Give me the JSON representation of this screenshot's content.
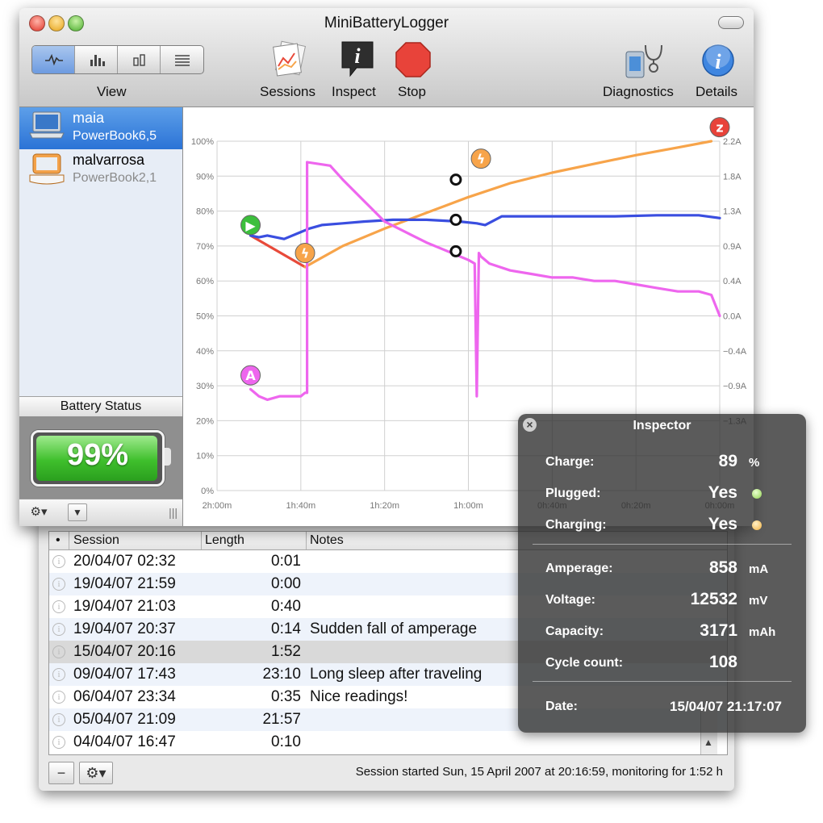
{
  "sessions_window": {
    "columns": [
      "•",
      "Session",
      "Length",
      "Notes"
    ],
    "rows": [
      {
        "date": "20/04/07 02:32",
        "length": "0:01",
        "note": ""
      },
      {
        "date": "19/04/07 21:59",
        "length": "0:00",
        "note": ""
      },
      {
        "date": "19/04/07 21:03",
        "length": "0:40",
        "note": ""
      },
      {
        "date": "19/04/07 20:37",
        "length": "0:14",
        "note": "Sudden fall of amperage"
      },
      {
        "date": "15/04/07 20:16",
        "length": "1:52",
        "note": ""
      },
      {
        "date": "09/04/07 17:43",
        "length": "23:10",
        "note": "Long sleep after traveling"
      },
      {
        "date": "06/04/07 23:34",
        "length": "0:35",
        "note": "Nice readings!"
      },
      {
        "date": "05/04/07 21:09",
        "length": "21:57",
        "note": ""
      },
      {
        "date": "04/04/07 16:47",
        "length": "0:10",
        "note": ""
      }
    ],
    "selected_row": 4,
    "remove_button": "−",
    "gear_button": "⚙▾",
    "status": "Session started Sun, 15 April 2007 at 20:16:59, monitoring for 1:52 h"
  },
  "main_window": {
    "title": "MiniBatteryLogger",
    "toolbar": {
      "view_label": "View",
      "sessions_label": "Sessions",
      "inspect_label": "Inspect",
      "stop_label": "Stop",
      "diagnostics_label": "Diagnostics",
      "details_label": "Details"
    },
    "sidebar": {
      "hosts": [
        {
          "name": "maia",
          "model": "PowerBook6,5"
        },
        {
          "name": "malvarrosa",
          "model": "PowerBook2,1"
        }
      ],
      "battery_status_label": "Battery Status",
      "battery_percent": "99%",
      "battery_level": 0.99
    },
    "colors": {
      "charge": "#f7a44a",
      "amperage": "#3a4ee0",
      "voltage": "#ee66ee",
      "discharge": "#e84a3a",
      "selection": "#2b73d6"
    }
  },
  "chart_data": {
    "type": "line",
    "y_left_ticks": [
      "100%",
      "90%",
      "80%",
      "70%",
      "60%",
      "50%",
      "40%",
      "30%",
      "20%",
      "10%",
      "0%"
    ],
    "y_right_ticks": [
      "2.2A",
      "1.8A",
      "1.3A",
      "0.9A",
      "0.4A",
      "0.0A",
      "−0.4A",
      "−0.9A",
      "−1.3A"
    ],
    "x_ticks": [
      "2h:00m",
      "1h:40m",
      "1h:20m",
      "1h:00m",
      "0h:40m",
      "0h:20m",
      "0h:00m"
    ],
    "x_range_min": [
      120,
      0
    ],
    "grid": true,
    "series": [
      {
        "key": "charge_discharge",
        "color": "#e84a3a",
        "x": [
          112,
          99
        ],
        "y": [
          73,
          64
        ]
      },
      {
        "key": "charge",
        "color": "#f7a44a",
        "x": [
          99,
          90,
          80,
          70,
          60,
          50,
          40,
          30,
          20,
          10,
          2
        ],
        "y": [
          64,
          70,
          75,
          79.5,
          84,
          88,
          91,
          93.5,
          96,
          98.2,
          100
        ]
      },
      {
        "key": "amperage",
        "color": "#3a4ee0",
        "x": [
          112,
          110,
          108,
          104,
          100,
          98,
          95,
          90,
          85,
          78,
          70,
          62,
          58,
          56,
          52,
          45,
          35,
          25,
          15,
          5,
          0
        ],
        "y": [
          73,
          72.5,
          73,
          72,
          74,
          75,
          76,
          76.5,
          77,
          77.5,
          77.5,
          77,
          76.5,
          76,
          78.5,
          78.5,
          78.5,
          78.5,
          78.8,
          78.8,
          78
        ]
      },
      {
        "key": "voltage",
        "color": "#ee66ee",
        "x": [
          112,
          110,
          108,
          105,
          103,
          100,
          99,
          98.5,
          98.5,
          93,
          90,
          85,
          80,
          75,
          70,
          66,
          62,
          60,
          58.5,
          58,
          57.5,
          57,
          55,
          50,
          45,
          40,
          35,
          30,
          25,
          20,
          15,
          10,
          5,
          2,
          0
        ],
        "y": [
          29,
          27,
          26,
          27,
          27,
          27,
          28,
          28,
          94,
          93,
          89,
          83,
          77,
          74,
          71,
          69,
          67,
          66,
          65,
          27,
          68,
          67,
          65,
          63,
          62,
          61,
          61,
          60,
          60,
          59,
          58,
          57,
          57,
          56,
          50
        ]
      }
    ],
    "markers": [
      {
        "key": "start",
        "label": "▶",
        "x": 112,
        "y": 76,
        "color": "#3cbf3c"
      },
      {
        "key": "plug",
        "label": "ϟ",
        "x": 99,
        "y": 68,
        "color": "#f7a44a"
      },
      {
        "key": "plug2",
        "label": "ϟ",
        "x": 57,
        "y": 95,
        "color": "#f7a44a"
      },
      {
        "key": "amp",
        "label": "A",
        "x": 112,
        "y": 33,
        "color": "#ee66ee"
      },
      {
        "key": "stop",
        "label": "z",
        "x": 0,
        "y": 104,
        "color": "#e8433a"
      }
    ],
    "cursor_x": 63
  },
  "inspector": {
    "title": "Inspector",
    "close": "×",
    "charge_label": "Charge:",
    "charge_value": "89",
    "charge_unit": "%",
    "plugged_label": "Plugged:",
    "plugged_value": "Yes",
    "charging_label": "Charging:",
    "charging_value": "Yes",
    "amperage_label": "Amperage:",
    "amperage_value": "858",
    "amperage_unit": "mA",
    "voltage_label": "Voltage:",
    "voltage_value": "12532",
    "voltage_unit": "mV",
    "capacity_label": "Capacity:",
    "capacity_value": "3171",
    "capacity_unit": "mAh",
    "cycle_label": "Cycle count:",
    "cycle_value": "108",
    "date_label": "Date:",
    "date_value": "15/04/07 21:17:07",
    "plugged_color": "#8fd14f",
    "charging_color": "#f3b13e"
  }
}
